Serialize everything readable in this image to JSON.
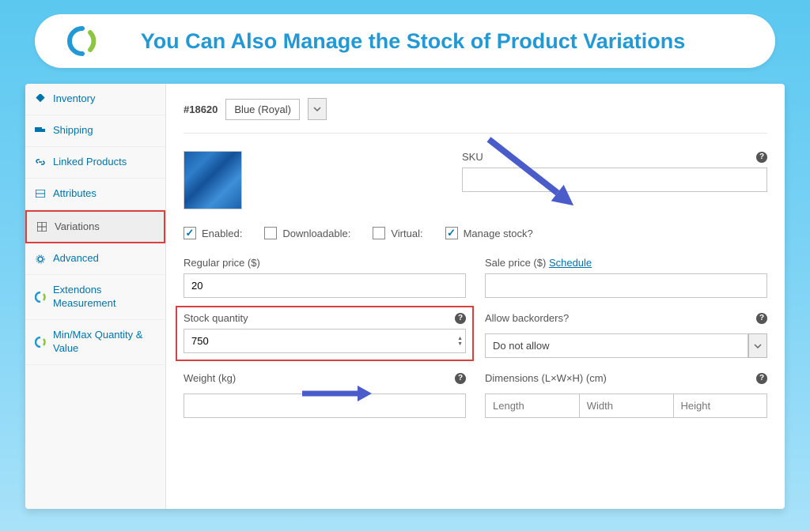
{
  "title": "You Can Also Manage the Stock of Product Variations",
  "sidebar": {
    "items": [
      {
        "label": "Inventory",
        "icon": "diamond"
      },
      {
        "label": "Shipping",
        "icon": "truck"
      },
      {
        "label": "Linked Products",
        "icon": "link"
      },
      {
        "label": "Attributes",
        "icon": "list"
      },
      {
        "label": "Variations",
        "icon": "grid",
        "active": true
      },
      {
        "label": "Advanced",
        "icon": "gear"
      },
      {
        "label": "Extendons Measurement",
        "icon": "ext"
      },
      {
        "label": "Min/Max Quantity & Value",
        "icon": "ext"
      }
    ]
  },
  "variation": {
    "id_label": "#18620",
    "color_selected": "Blue (Royal)",
    "sku_label": "SKU",
    "sku_value": "",
    "checkboxes": {
      "enabled": {
        "label": "Enabled:",
        "checked": true
      },
      "downloadable": {
        "label": "Downloadable:",
        "checked": false
      },
      "virtual": {
        "label": "Virtual:",
        "checked": false
      },
      "manage_stock": {
        "label": "Manage stock?",
        "checked": true
      }
    },
    "regular_price": {
      "label": "Regular price ($)",
      "value": "20"
    },
    "sale_price": {
      "label": "Sale price ($)",
      "schedule": "Schedule",
      "value": ""
    },
    "stock_quantity": {
      "label": "Stock quantity",
      "value": "750"
    },
    "backorders": {
      "label": "Allow backorders?",
      "value": "Do not allow"
    },
    "weight": {
      "label": "Weight (kg)",
      "value": ""
    },
    "dimensions": {
      "label": "Dimensions (L×W×H) (cm)",
      "length_ph": "Length",
      "width_ph": "Width",
      "height_ph": "Height"
    }
  }
}
